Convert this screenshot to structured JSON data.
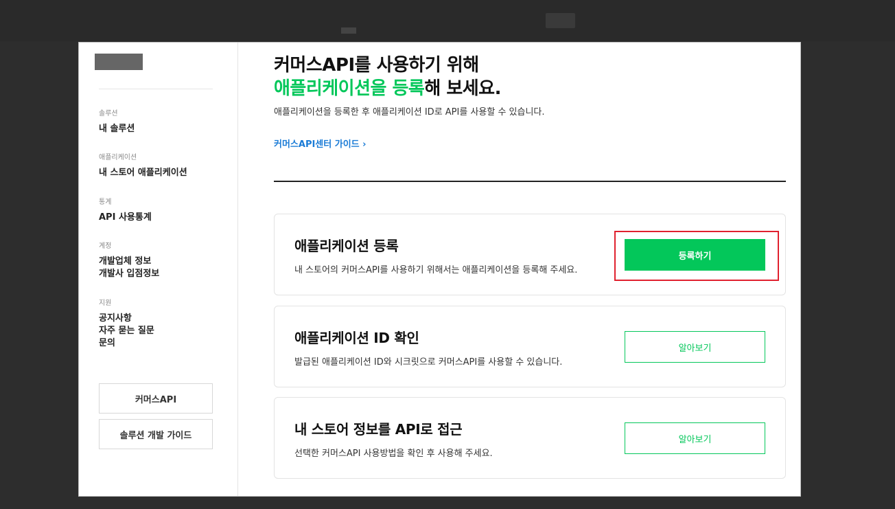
{
  "sidebar": {
    "groups": [
      {
        "category": "솔루션",
        "items": [
          "내 솔루션"
        ]
      },
      {
        "category": "애플리케이션",
        "items": [
          "내 스토어 애플리케이션"
        ]
      },
      {
        "category": "통계",
        "items": [
          "API 사용통계"
        ]
      },
      {
        "category": "계정",
        "items": [
          "개발업체 정보",
          "개발사 입점정보"
        ]
      },
      {
        "category": "지원",
        "items": [
          "공지사항",
          "자주 묻는 질문",
          "문의"
        ]
      }
    ],
    "buttons": [
      "커머스API",
      "솔루션 개발 가이드"
    ]
  },
  "hero": {
    "line1": "커머스API를 사용하기 위해",
    "line2_green": "애플리케이션을 등록",
    "line2_rest": "해 보세요.",
    "description": "애플리케이션을 등록한 후 애플리케이션 ID로 API를 사용할 수 있습니다.",
    "guide_link": "커머스API센터 가이드",
    "guide_arrow": "›"
  },
  "cards": [
    {
      "title": "애플리케이션 등록",
      "description": "내 스토어의 커머스API를 사용하기 위해서는 애플리케이션을 등록해 주세요.",
      "button": "등록하기"
    },
    {
      "title": "애플리케이션 ID 확인",
      "description": "발급된 애플리케이션 ID와 시크릿으로 커머스API를 사용할 수 있습니다.",
      "button": "알아보기"
    },
    {
      "title": "내 스토어 정보를 API로 접근",
      "description": "선택한 커머스API 사용방법을 확인 후 사용해 주세요.",
      "button": "알아보기"
    }
  ],
  "colors": {
    "accent_green": "#03c75a",
    "link_blue": "#1a7bd6",
    "highlight_red": "#e0202e"
  }
}
